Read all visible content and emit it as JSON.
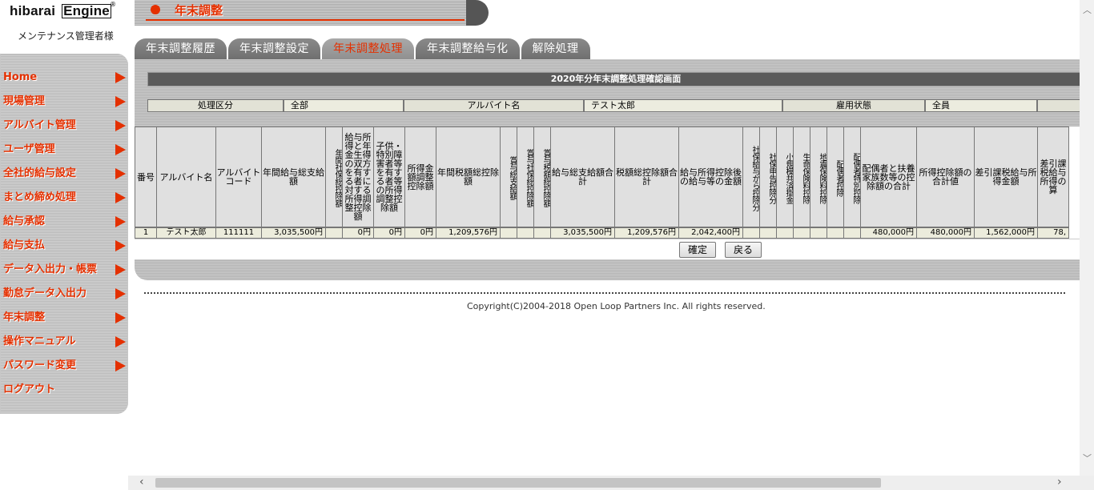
{
  "logo": {
    "brand": "hibarai",
    "brand_e": "Engine",
    "reg": "®",
    "user": "メンテナンス管理者様"
  },
  "sidebar": {
    "items": [
      {
        "label": "Home"
      },
      {
        "label": "現場管理"
      },
      {
        "label": "アルバイト管理"
      },
      {
        "label": "ユーザ管理"
      },
      {
        "label": "全社的給与設定"
      },
      {
        "label": "まとめ締め処理"
      },
      {
        "label": "給与承認"
      },
      {
        "label": "給与支払"
      },
      {
        "label": "データ入出力・帳票"
      },
      {
        "label": "勤怠データ入出力"
      },
      {
        "label": "年末調整"
      },
      {
        "label": "操作マニュアル"
      },
      {
        "label": "パスワード変更"
      },
      {
        "label": "ログアウト"
      }
    ]
  },
  "header": {
    "title": "年末調整"
  },
  "tabs": [
    {
      "label": "年末調整履歴"
    },
    {
      "label": "年末調整設定"
    },
    {
      "label": "年末調整処理",
      "active": true
    },
    {
      "label": "年末調整給与化"
    },
    {
      "label": "解除処理"
    }
  ],
  "panel": {
    "title": "2020年分年末調整処理確認画面"
  },
  "filter": {
    "process_label": "処理区分",
    "process_value": "全部",
    "worker_label": "アルバイト名",
    "worker_value": "テスト太郎",
    "employment_label": "雇用状態",
    "employment_value": "全員"
  },
  "table": {
    "headers": [
      "番号",
      "アルバイト名",
      "アルバイトコード",
      "年間給与総支給額",
      "年間社保総控除額",
      "給与所得と年金生得の双方を有する者に対する所得調整控除額",
      "子供・特別障害者等を有する者等の所得調整控除額",
      "所得金額調整控除額",
      "年間税額総控除額",
      "賞与総支給額",
      "賞与社保総控除額",
      "賞与税額総控除額",
      "給与総支給額合計",
      "税額総控除額合計",
      "給与所得控除後の給与等の金額",
      "社保給与から控除分",
      "社保申告控除分",
      "小規模共済掛金",
      "生命保険料控除",
      "地震保険料控除",
      "配偶者控除",
      "配偶者特別控除",
      "配偶者と扶養家族数等の控除額の合計",
      "所得控除額の合計値",
      "差引課税給与所得金額",
      "差引課税給与所得の算"
    ],
    "rows": [
      [
        "1",
        "テスト太郎",
        "111111",
        "3,035,500円",
        "",
        "0円",
        "0円",
        "0円",
        "1,209,576円",
        "",
        "",
        "",
        "3,035,500円",
        "1,209,576円",
        "2,042,400円",
        "",
        "",
        "",
        "",
        "",
        "",
        "",
        "480,000円",
        "480,000円",
        "1,562,000円",
        "78,"
      ]
    ]
  },
  "buttons": {
    "confirm": "確定",
    "back": "戻る"
  },
  "footer": {
    "copyright": "Copyright(C)2004-2018 Open Loop Partners Inc. All rights reserved."
  }
}
